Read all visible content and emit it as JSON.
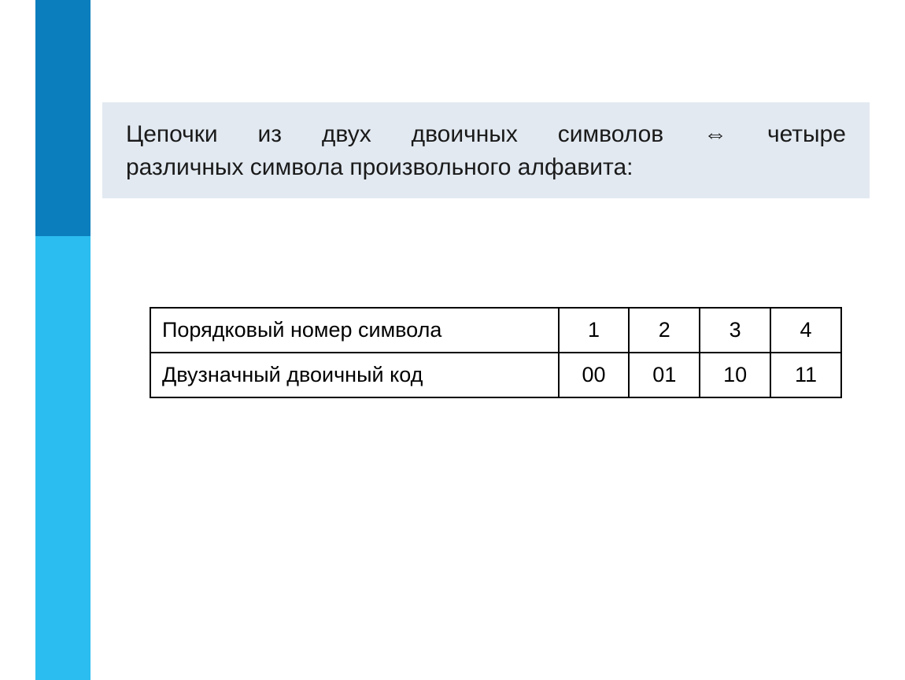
{
  "header": {
    "line1_words": [
      "Цепочки",
      "из",
      "двух",
      "двоичных",
      "символов",
      "⇔",
      "четыре"
    ],
    "line2": "различных символа произвольного алфавита:"
  },
  "table": {
    "row1_label": "Порядковый номер символа",
    "row1_values": [
      "1",
      "2",
      "3",
      "4"
    ],
    "row2_label": "Двузначный двоичный код",
    "row2_values": [
      "00",
      "01",
      "10",
      "11"
    ]
  },
  "chart_data": {
    "type": "table",
    "rows": [
      {
        "label": "Порядковый номер символа",
        "values": [
          "1",
          "2",
          "3",
          "4"
        ]
      },
      {
        "label": "Двузначный двоичный код",
        "values": [
          "00",
          "01",
          "10",
          "11"
        ]
      }
    ]
  }
}
